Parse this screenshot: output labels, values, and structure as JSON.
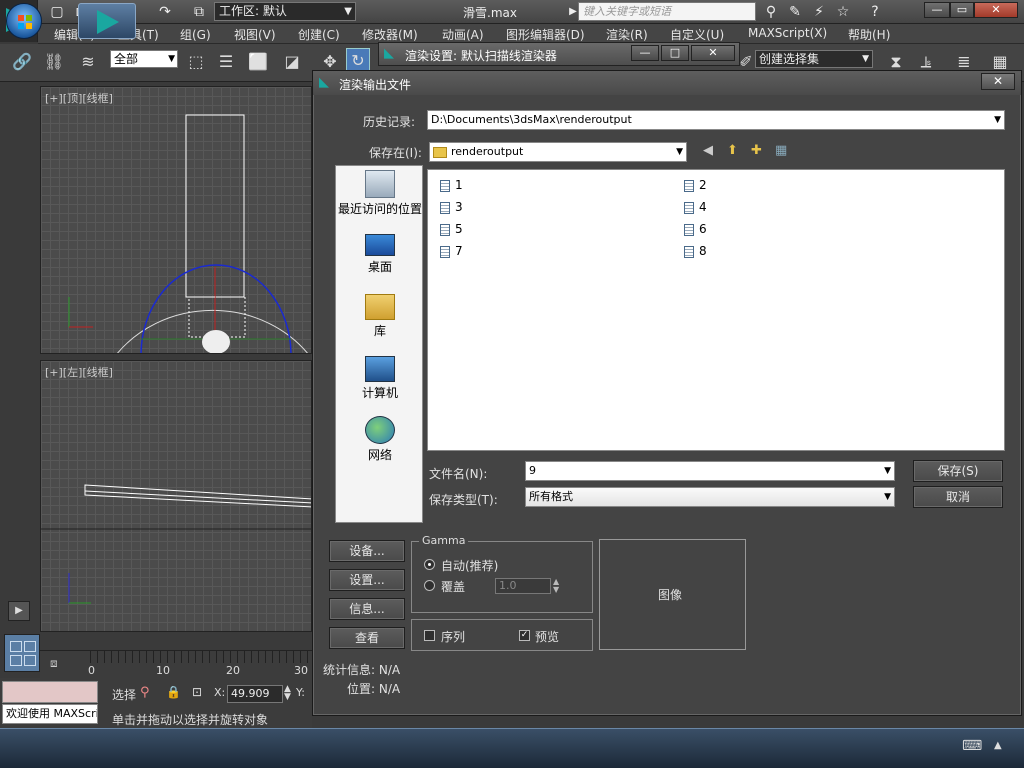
{
  "titlebar": {
    "workspace": "工作区: 默认",
    "file_title": "滑雪.max",
    "search_placeholder": "键入关键字或短语",
    "win_minimize": "—",
    "win_restore": "▭",
    "win_close": "✕"
  },
  "menubar": {
    "items": [
      "编辑(E)",
      "工具(T)",
      "组(G)",
      "视图(V)",
      "创建(C)",
      "修改器(M)",
      "动画(A)",
      "图形编辑器(D)",
      "渲染(R)",
      "自定义(U)",
      "MAXScript(X)",
      "帮助(H)"
    ]
  },
  "toolbar": {
    "selection_filter": "全部",
    "named_selection": "创建选择集"
  },
  "viewports": {
    "top_label": "[+][顶][线框]",
    "left_label": "[+][左][线框]"
  },
  "timeline": {
    "ticks": [
      "0",
      "10",
      "20",
      "30"
    ]
  },
  "status": {
    "welcome": "欢迎使用 MAXScript",
    "select_label": "选择",
    "x_label": "X:",
    "x_value": "49.909",
    "y_label": "Y:",
    "prompt": "单击并拖动以选择并旋转对象"
  },
  "render_setup": {
    "title": "渲染设置: 默认扫描线渲染器",
    "minimize": "—",
    "maximize": "□",
    "close": "✕"
  },
  "dialog": {
    "title": "渲染输出文件",
    "close": "✕",
    "history_label": "历史记录:",
    "history_value": "D:\\Documents\\3dsMax\\renderoutput",
    "save_in_label": "保存在(I):",
    "save_in_value": "renderoutput",
    "places": [
      "最近访问的位置",
      "桌面",
      "库",
      "计算机",
      "网络"
    ],
    "files": [
      "1",
      "2",
      "3",
      "4",
      "5",
      "6",
      "7",
      "8"
    ],
    "filename_label": "文件名(N):",
    "filename_value": "9",
    "filetype_label": "保存类型(T):",
    "filetype_value": "所有格式",
    "save_button": "保存(S)",
    "cancel_button": "取消",
    "setup_button_1": "设备...",
    "setup_button_2": "设置...",
    "info_button": "信息...",
    "view_button": "查看",
    "gamma_title": "Gamma",
    "gamma_auto": "自动(推荐)",
    "gamma_override": "覆盖",
    "gamma_value": "1.0",
    "sequence_label": "序列",
    "preview_label": "预览",
    "image_label": "图像",
    "stats_label": "统计信息: N/A",
    "location_label": "位置: N/A"
  }
}
